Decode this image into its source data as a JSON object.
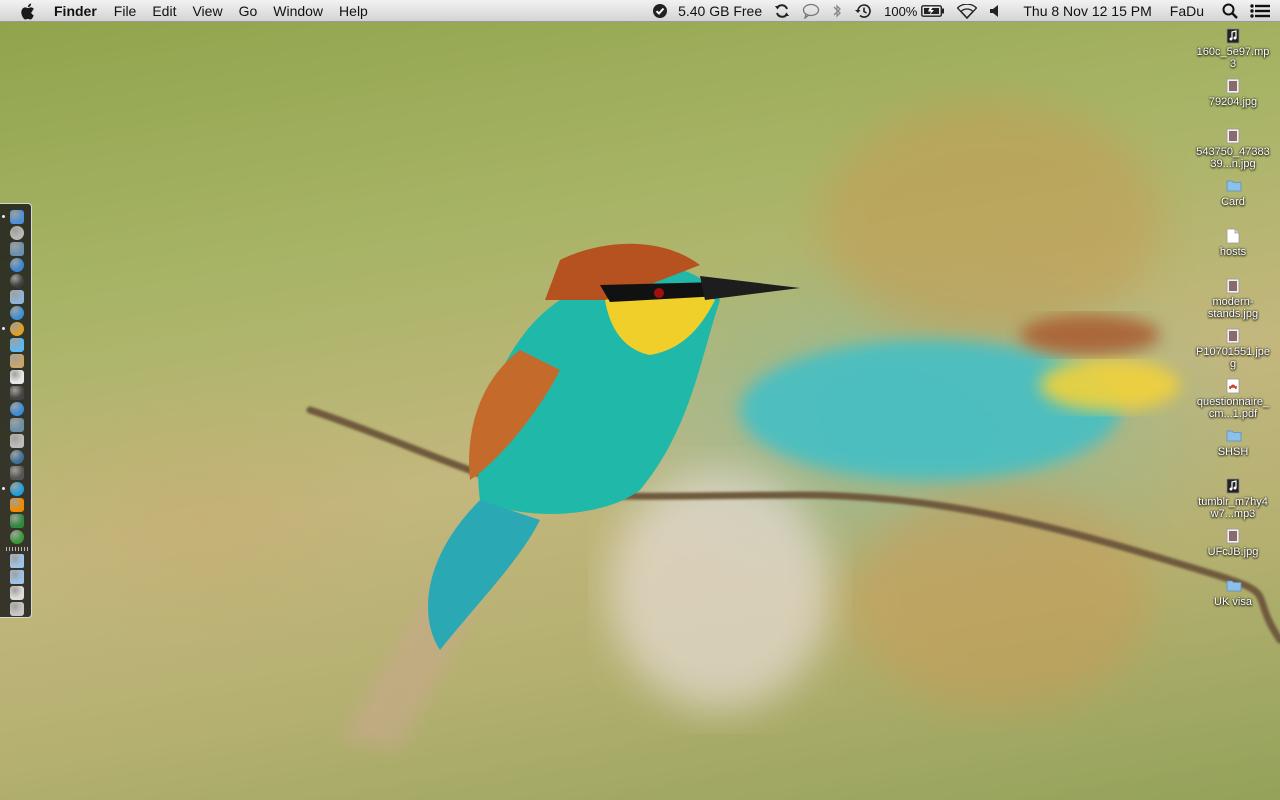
{
  "menubar": {
    "app_name": "Finder",
    "menus": [
      "File",
      "Edit",
      "View",
      "Go",
      "Window",
      "Help"
    ],
    "disk_free": "5.40 GB Free",
    "battery": "100%",
    "datetime": "Thu 8 Nov  12 15 PM",
    "user": "FaDu"
  },
  "dock": {
    "icons": [
      {
        "name": "finder-icon",
        "color": "#4f8fd8"
      },
      {
        "name": "launchpad-icon",
        "color": "#b9b9b9"
      },
      {
        "name": "mission-control-icon",
        "color": "#6c8fb0"
      },
      {
        "name": "safari-icon",
        "color": "#3a86d6"
      },
      {
        "name": "dashboard-icon",
        "color": "#3e3e3e"
      },
      {
        "name": "mail-icon",
        "color": "#8fb3d6"
      },
      {
        "name": "app-store-icon",
        "color": "#3c8fd8"
      },
      {
        "name": "chrome-icon",
        "color": "#e0a020"
      },
      {
        "name": "messages-icon",
        "color": "#5db7f0"
      },
      {
        "name": "contacts-icon",
        "color": "#c9a56a"
      },
      {
        "name": "calendar-icon",
        "color": "#e8e8e8"
      },
      {
        "name": "photo-booth-icon",
        "color": "#444444"
      },
      {
        "name": "itunes-icon",
        "color": "#3a8cdc"
      },
      {
        "name": "iphoto-icon",
        "color": "#6b8fa8"
      },
      {
        "name": "preview-icon",
        "color": "#bdbdbd"
      },
      {
        "name": "time-machine-icon",
        "color": "#3c6f9a"
      },
      {
        "name": "facetime-icon",
        "color": "#555555"
      },
      {
        "name": "skype-icon",
        "color": "#1ea0e0"
      },
      {
        "name": "vlc-icon",
        "color": "#f08a00"
      },
      {
        "name": "excel-icon",
        "color": "#2e8a3e"
      },
      {
        "name": "utorrent-icon",
        "color": "#3a9a3a"
      },
      {
        "name": "applications-folder-icon",
        "color": "#9ec3e8"
      },
      {
        "name": "documents-folder-icon",
        "color": "#9ec3e8"
      },
      {
        "name": "downloads-stack-icon",
        "color": "#dcdcdc"
      },
      {
        "name": "trash-icon",
        "color": "#c8c8c8"
      }
    ]
  },
  "desktop": {
    "items": [
      {
        "label": "160c_5e97.mp3",
        "kind": "audio"
      },
      {
        "label": "79204.jpg",
        "kind": "image"
      },
      {
        "label": "543750_4738339...n.jpg",
        "kind": "image"
      },
      {
        "label": "Card",
        "kind": "folder"
      },
      {
        "label": "hosts",
        "kind": "document"
      },
      {
        "label": "modern-stands.jpg",
        "kind": "image"
      },
      {
        "label": "P10701551.jpeg",
        "kind": "image"
      },
      {
        "label": "questionnaire_cm...1.pdf",
        "kind": "pdf"
      },
      {
        "label": "SHSH",
        "kind": "folder"
      },
      {
        "label": "tumblr_m7hy4w7...mp3",
        "kind": "audio"
      },
      {
        "label": "UFcJB.jpg",
        "kind": "image"
      },
      {
        "label": "UK visa",
        "kind": "folder"
      }
    ]
  },
  "colors": {
    "folder": "#8cc0ea",
    "pdf": "#d03a2a",
    "menubar_top": "#f2f2f2",
    "menubar_bottom": "#d4d4d4"
  }
}
